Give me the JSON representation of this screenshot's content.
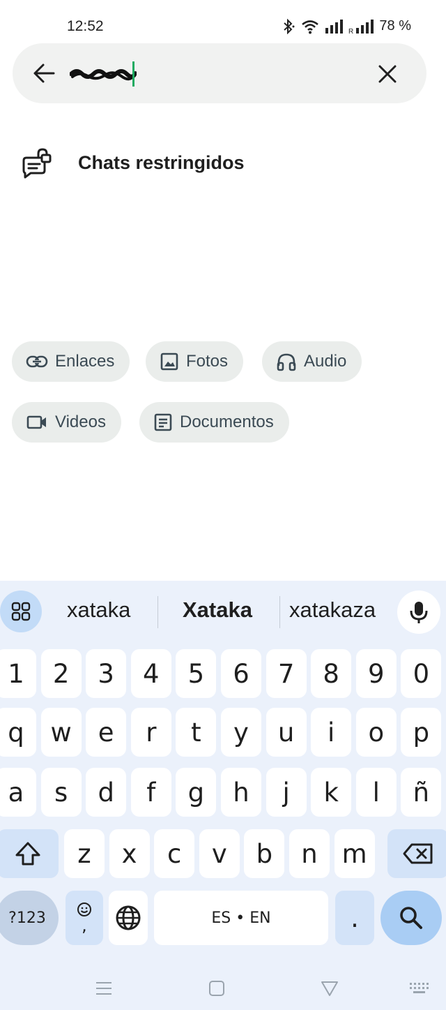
{
  "status_bar": {
    "time": "12:52",
    "battery": "78 %",
    "icons": [
      "bluetooth-icon",
      "wifi-icon",
      "signal-icon",
      "roaming-signal-icon"
    ]
  },
  "search": {
    "value": "",
    "redacted_text_visible": true
  },
  "restricted_chats": {
    "label": "Chats restringidos",
    "icon": "restricted-chat-icon"
  },
  "filters": [
    {
      "label": "Enlaces",
      "icon": "link-icon"
    },
    {
      "label": "Fotos",
      "icon": "image-icon"
    },
    {
      "label": "Audio",
      "icon": "headphones-icon"
    },
    {
      "label": "Videos",
      "icon": "video-icon"
    },
    {
      "label": "Documentos",
      "icon": "document-icon"
    }
  ],
  "keyboard": {
    "suggestions": [
      "xataka",
      "Xataka",
      "xatakaza"
    ],
    "number_row": [
      "1",
      "2",
      "3",
      "4",
      "5",
      "6",
      "7",
      "8",
      "9",
      "0"
    ],
    "row1": [
      "q",
      "w",
      "e",
      "r",
      "t",
      "y",
      "u",
      "i",
      "o",
      "p"
    ],
    "row2": [
      "a",
      "s",
      "d",
      "f",
      "g",
      "h",
      "j",
      "k",
      "l",
      "ñ"
    ],
    "row3": [
      "z",
      "x",
      "c",
      "v",
      "b",
      "n",
      "m"
    ],
    "symbols_key": "?123",
    "emoji_key_sub": ",",
    "space_label": "ES • EN",
    "period_key": "."
  },
  "colors": {
    "accent_green": "#1dab61",
    "search_bg": "#f1f2f1",
    "chip_bg": "#eaedeb",
    "keyboard_bg": "#ebf1fb",
    "action_key": "#a9cdf4"
  }
}
